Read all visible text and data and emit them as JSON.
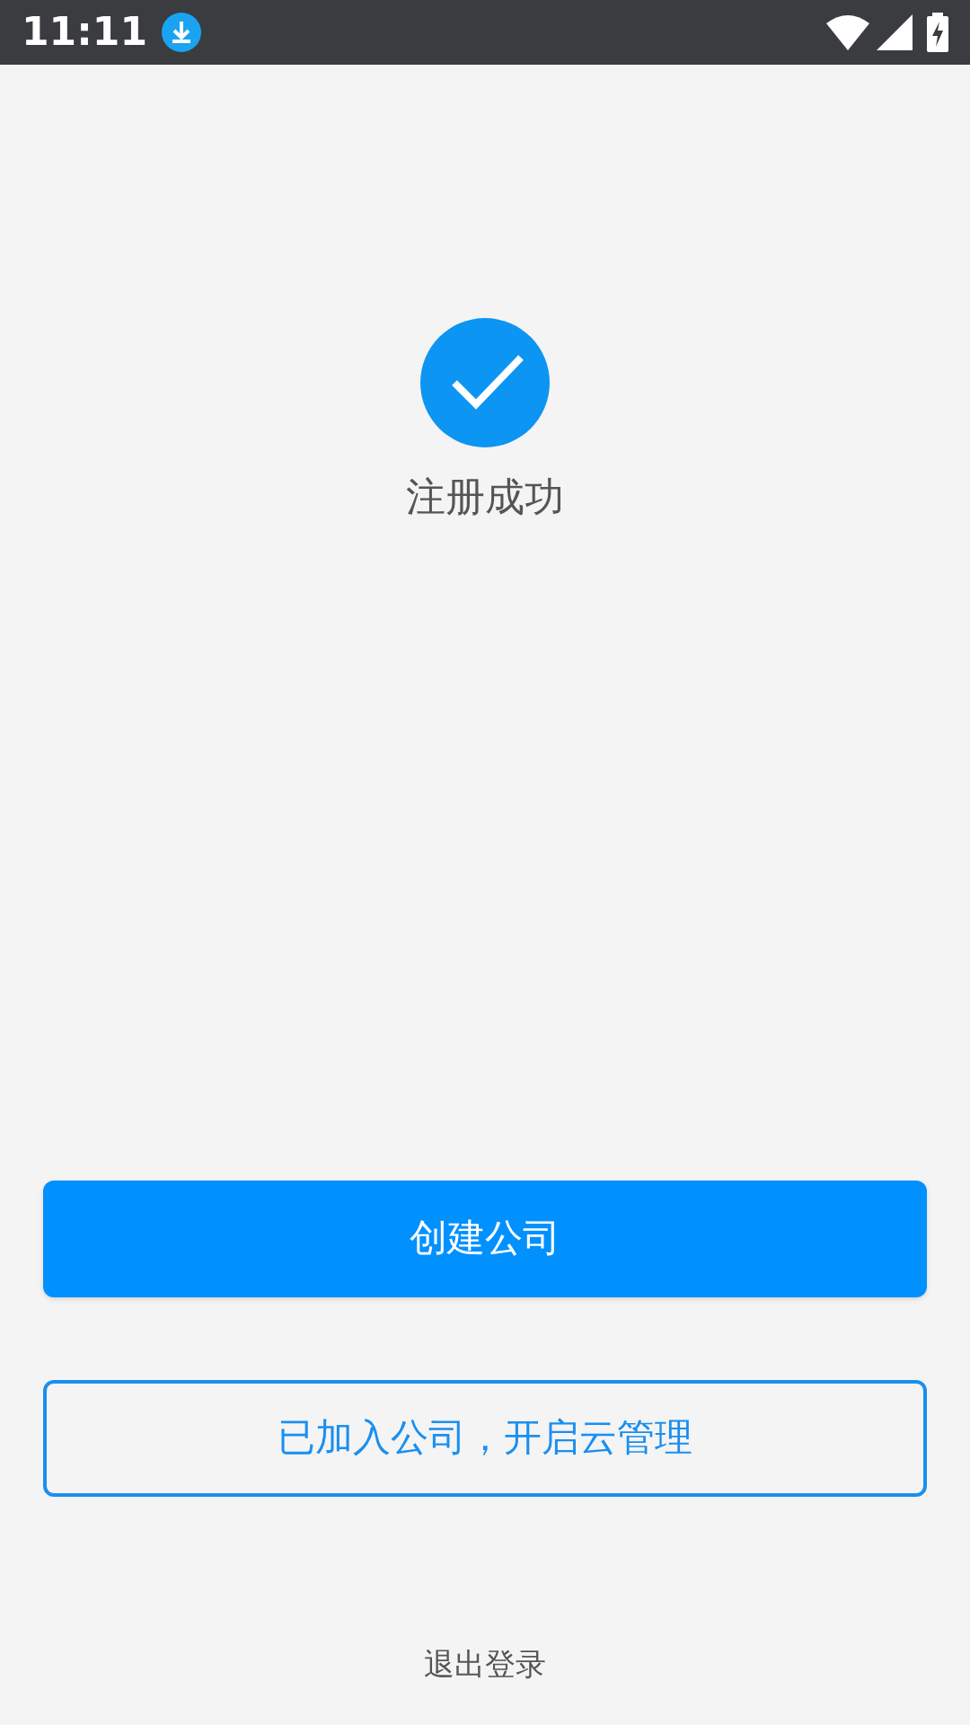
{
  "status_bar": {
    "time": "11:11"
  },
  "result": {
    "title": "注册成功"
  },
  "buttons": [
    {
      "label": "创建公司",
      "kind": "primary"
    },
    {
      "label": "已加入公司，开启云管理",
      "kind": "outline"
    }
  ],
  "logout": "退出登录"
}
